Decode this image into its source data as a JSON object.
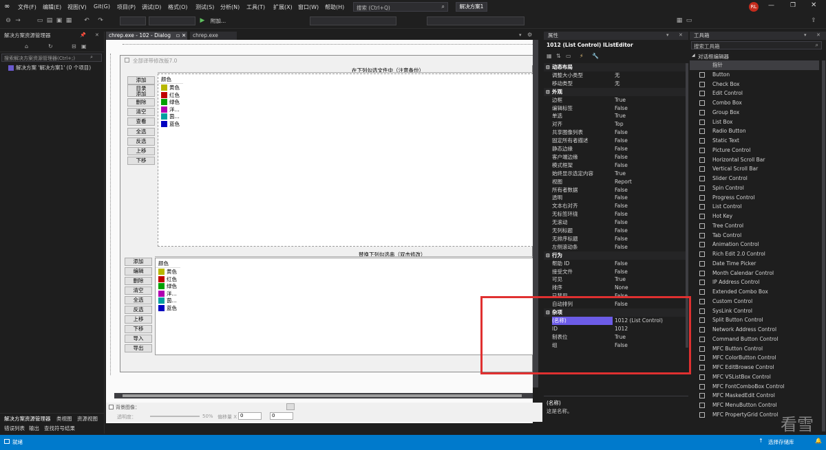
{
  "menu": [
    "文件(F)",
    "编辑(E)",
    "视图(V)",
    "Git(G)",
    "项目(P)",
    "调试(D)",
    "格式(O)",
    "测试(S)",
    "分析(N)",
    "工具(T)",
    "扩展(X)",
    "窗口(W)",
    "帮助(H)"
  ],
  "search": {
    "placeholder": "搜索 (Ctrl+Q)"
  },
  "solution_badge": "解决方案1",
  "avatar": "RL",
  "toolbar": {
    "attach_label": "附加...",
    "undo_icon": "undo-icon",
    "save_icon": "save-icon"
  },
  "left_panel": {
    "title": "解决方案资源管理器",
    "search_placeholder": "搜索解决方案资源管理器(Ctrl+;)",
    "tree_item": "解决方案 '解决方案1' (0 个项目)",
    "bottom_tabs": [
      "解决方案资源管理器",
      "类视图",
      "资源视图"
    ]
  },
  "doc_tabs": [
    "chrep.exe - 102 - Dialog",
    "chrep.exe"
  ],
  "dialog": {
    "title": "全部译带修改版7.0",
    "group1_title": "在下列勾选文件中（注意备份）",
    "group2_title": "替换下列勾选串（双击修改）",
    "buttons1": [
      "添加",
      "目录\n添加",
      "删除",
      "清空",
      "查看",
      "全选",
      "反选",
      "上移",
      "下移"
    ],
    "buttons2": [
      "添加",
      "编辑",
      "删除",
      "清空",
      "全选",
      "反选",
      "上移",
      "下移",
      "导入",
      "导出"
    ],
    "list_header": "颜色",
    "list2_header": "颜色",
    "list_items": [
      {
        "label": "黄色",
        "color": "#b8b800"
      },
      {
        "label": "红色",
        "color": "#c00000"
      },
      {
        "label": "绿色",
        "color": "#00a000"
      },
      {
        "label": "洋...",
        "color": "#b000b0"
      },
      {
        "label": "茵...",
        "color": "#00a0a0"
      },
      {
        "label": "蓝色",
        "color": "#0000c0"
      }
    ]
  },
  "designer_bottom": {
    "bg_image_label": "背景图像：",
    "opacity_label": "透明度：",
    "opacity_value": "50%",
    "offset_label": "偏移量 X",
    "offset_x": "0",
    "offset_y": "0"
  },
  "properties": {
    "panel_title": "属性",
    "object": "1012 (List Control) IListEditor",
    "rows": [
      {
        "k": "动态布局",
        "cat": true
      },
      {
        "k": "调整大小类型",
        "v": "无"
      },
      {
        "k": "移动类型",
        "v": "无"
      },
      {
        "k": "外观",
        "cat": true
      },
      {
        "k": "边框",
        "v": "True"
      },
      {
        "k": "编辑标签",
        "v": "False"
      },
      {
        "k": "单选",
        "v": "True"
      },
      {
        "k": "对齐",
        "v": "Top"
      },
      {
        "k": "共享图像列表",
        "v": "False"
      },
      {
        "k": "固定所有者描述",
        "v": "False"
      },
      {
        "k": "静态边缘",
        "v": "False"
      },
      {
        "k": "客户端边缘",
        "v": "False"
      },
      {
        "k": "模式框架",
        "v": "False"
      },
      {
        "k": "始终显示选定内容",
        "v": "True"
      },
      {
        "k": "视图",
        "v": "Report"
      },
      {
        "k": "所有者数据",
        "v": "False"
      },
      {
        "k": "透明",
        "v": "False"
      },
      {
        "k": "文本右对齐",
        "v": "False"
      },
      {
        "k": "无标签环绕",
        "v": "False"
      },
      {
        "k": "无滚动",
        "v": "False"
      },
      {
        "k": "无列标题",
        "v": "False"
      },
      {
        "k": "无排序标题",
        "v": "False"
      },
      {
        "k": "左侧滚动条",
        "v": "False"
      },
      {
        "k": "行为",
        "cat": true
      },
      {
        "k": "帮助 ID",
        "v": "False"
      },
      {
        "k": "接受文件",
        "v": "False"
      },
      {
        "k": "可见",
        "v": "True"
      },
      {
        "k": "排序",
        "v": "None"
      },
      {
        "k": "已禁用",
        "v": "False"
      },
      {
        "k": "自动排列",
        "v": "False"
      },
      {
        "k": "杂项",
        "cat": true
      },
      {
        "k": "(名称)",
        "v": "1012 (List Control)",
        "sel": true
      },
      {
        "k": "ID",
        "v": "1012"
      },
      {
        "k": "制表位",
        "v": "True"
      },
      {
        "k": "组",
        "v": "False"
      }
    ],
    "desc_title": "(名称)",
    "desc_text": "这是名称。"
  },
  "toolbox": {
    "title": "工具箱",
    "search_placeholder": "搜索工具箱",
    "group": "对话框编辑器",
    "items": [
      "指针",
      "Button",
      "Check Box",
      "Edit Control",
      "Combo Box",
      "Group Box",
      "List Box",
      "Radio Button",
      "Static Text",
      "Picture Control",
      "Horizontal Scroll Bar",
      "Vertical Scroll Bar",
      "Slider Control",
      "Spin Control",
      "Progress Control",
      "List Control",
      "Hot Key",
      "Tree Control",
      "Tab Control",
      "Animation Control",
      "Rich Edit 2.0 Control",
      "Date Time Picker",
      "Month Calendar Control",
      "IP Address Control",
      "Extended Combo Box",
      "Custom Control",
      "SysLink Control",
      "Split Button Control",
      "Network Address Control",
      "Command Button Control",
      "MFC Button Control",
      "MFC ColorButton Control",
      "MFC EditBrowse Control",
      "MFC VSListBox Control",
      "MFC FontComboBox Control",
      "MFC MaskedEdit Control",
      "MFC MenuButton Control",
      "MFC PropertyGrid Control"
    ]
  },
  "bottom_tabs": [
    "错误列表",
    "输出",
    "查找符号结果"
  ],
  "status": {
    "ready": "就绪",
    "source_control": "选择存储库"
  },
  "watermark": "看雪"
}
